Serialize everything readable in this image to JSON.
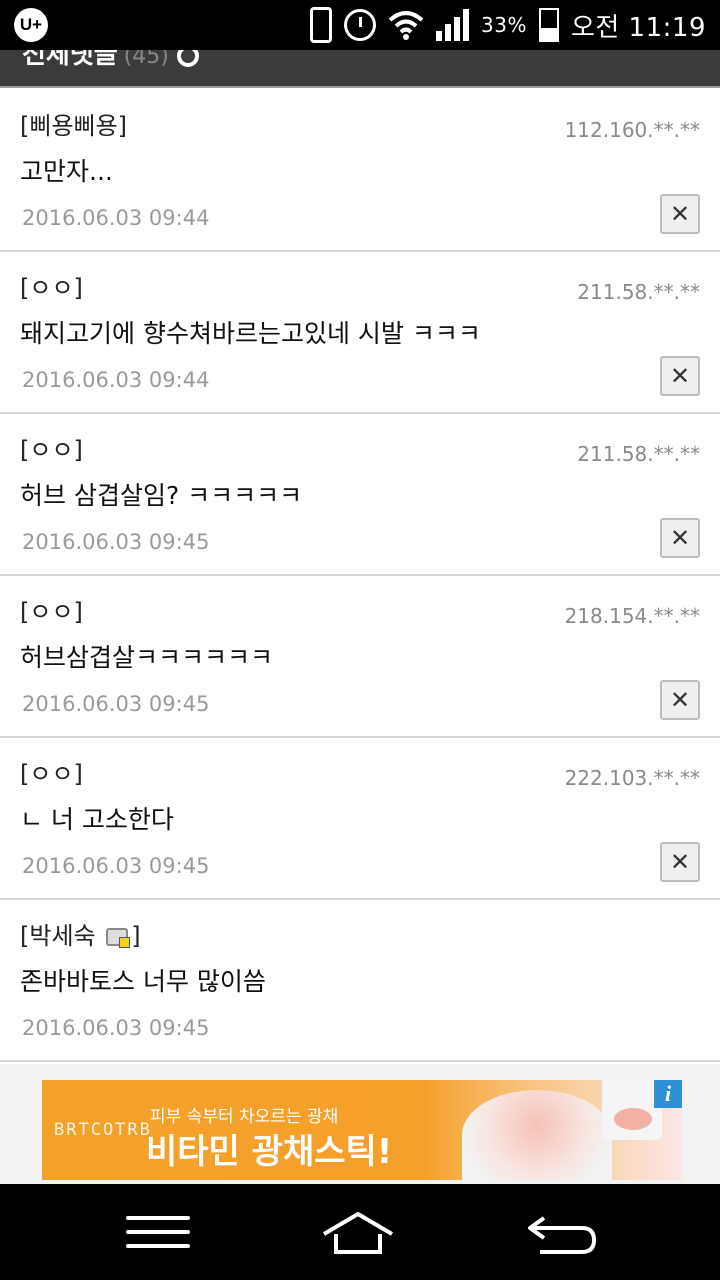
{
  "status_bar": {
    "carrier_logo": "U+",
    "battery_percent": "33%",
    "time": "오전 11:19",
    "icons": [
      "vibrate-icon",
      "alarm-icon",
      "wifi-icon",
      "signal-icon",
      "battery-icon"
    ]
  },
  "header": {
    "title": "전체댓글",
    "count": "(45)"
  },
  "comments": [
    {
      "author": "[삐용삐용]",
      "ip": "112.160.**.**",
      "text": "고만자...",
      "date": "2016.06.03 09:44",
      "deletable": true
    },
    {
      "author": "[ㅇㅇ]",
      "ip": "211.58.**.**",
      "text": "돼지고기에 향수쳐바르는고있네 시발 ㅋㅋㅋ",
      "date": "2016.06.03 09:44",
      "deletable": true
    },
    {
      "author": "[ㅇㅇ]",
      "ip": "211.58.**.**",
      "text": "허브 삼겹살임? ㅋㅋㅋㅋㅋ",
      "date": "2016.06.03 09:45",
      "deletable": true
    },
    {
      "author": "[ㅇㅇ]",
      "ip": "218.154.**.**",
      "text": "허브삼겹살ㅋㅋㅋㅋㅋㅋ",
      "date": "2016.06.03 09:45",
      "deletable": true
    },
    {
      "author": "[ㅇㅇ]",
      "ip": "222.103.**.**",
      "text": "ㄴ 너 고소한다",
      "date": "2016.06.03 09:45",
      "deletable": true
    },
    {
      "author_name": "[박세숙",
      "author_close": "]",
      "ip": "",
      "text": "존바바토스 너무 많이씀",
      "date": "2016.06.03 09:45",
      "deletable": false
    }
  ],
  "ad": {
    "brand": "BRTCOTRB",
    "subtitle": "피부 속부터 차오르는 광채",
    "headline": "비타민 광채스틱!",
    "info_label": "i"
  },
  "delete_label": "✕",
  "colors": {
    "status_bar_bg": "#000000",
    "header_bg": "#3b3b3b",
    "ad_orange": "#f4a128",
    "ad_info_blue": "#2d8fd6"
  }
}
